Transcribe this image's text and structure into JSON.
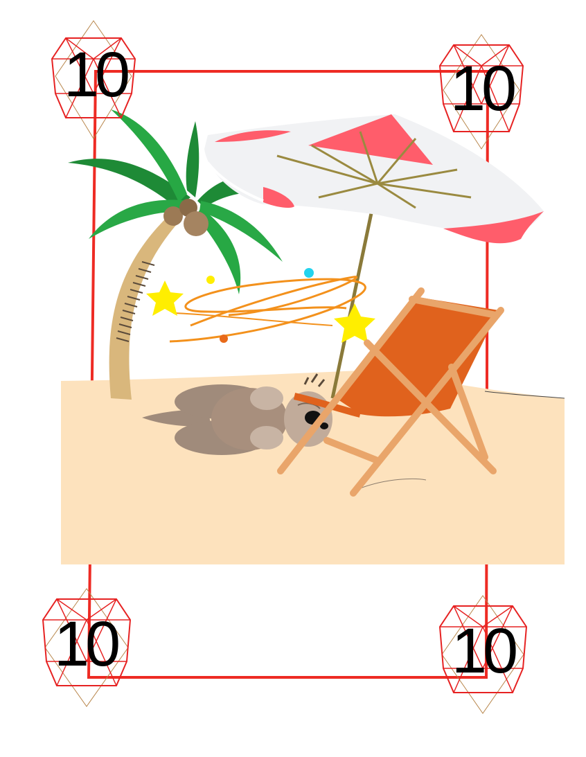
{
  "card": {
    "rank": "10",
    "colors": {
      "border": "#ee2b24",
      "gem": "#e62222",
      "gem_outline": "#b8864b",
      "sand": "#fde2bd",
      "umbrella_red": "#ff5d6b",
      "umbrella_white": "#f1f2f4",
      "chair_fabric": "#e0621d",
      "chair_frame": "#e9a56a",
      "palm_leaf": "#27a844",
      "palm_trunk": "#d9b77c",
      "creature": "#a08b7b",
      "star": "#ffee00",
      "swirl": "#f3911c"
    },
    "corners": [
      {
        "id": "top-left",
        "rank": "10"
      },
      {
        "id": "top-right",
        "rank": "10"
      },
      {
        "id": "bottom-left",
        "rank": "10"
      },
      {
        "id": "bottom-right",
        "rank": "10"
      }
    ],
    "icons": [
      "ruby-gem-icon",
      "palm-tree-icon",
      "beach-umbrella-icon",
      "deck-chair-icon",
      "star-icon"
    ]
  }
}
